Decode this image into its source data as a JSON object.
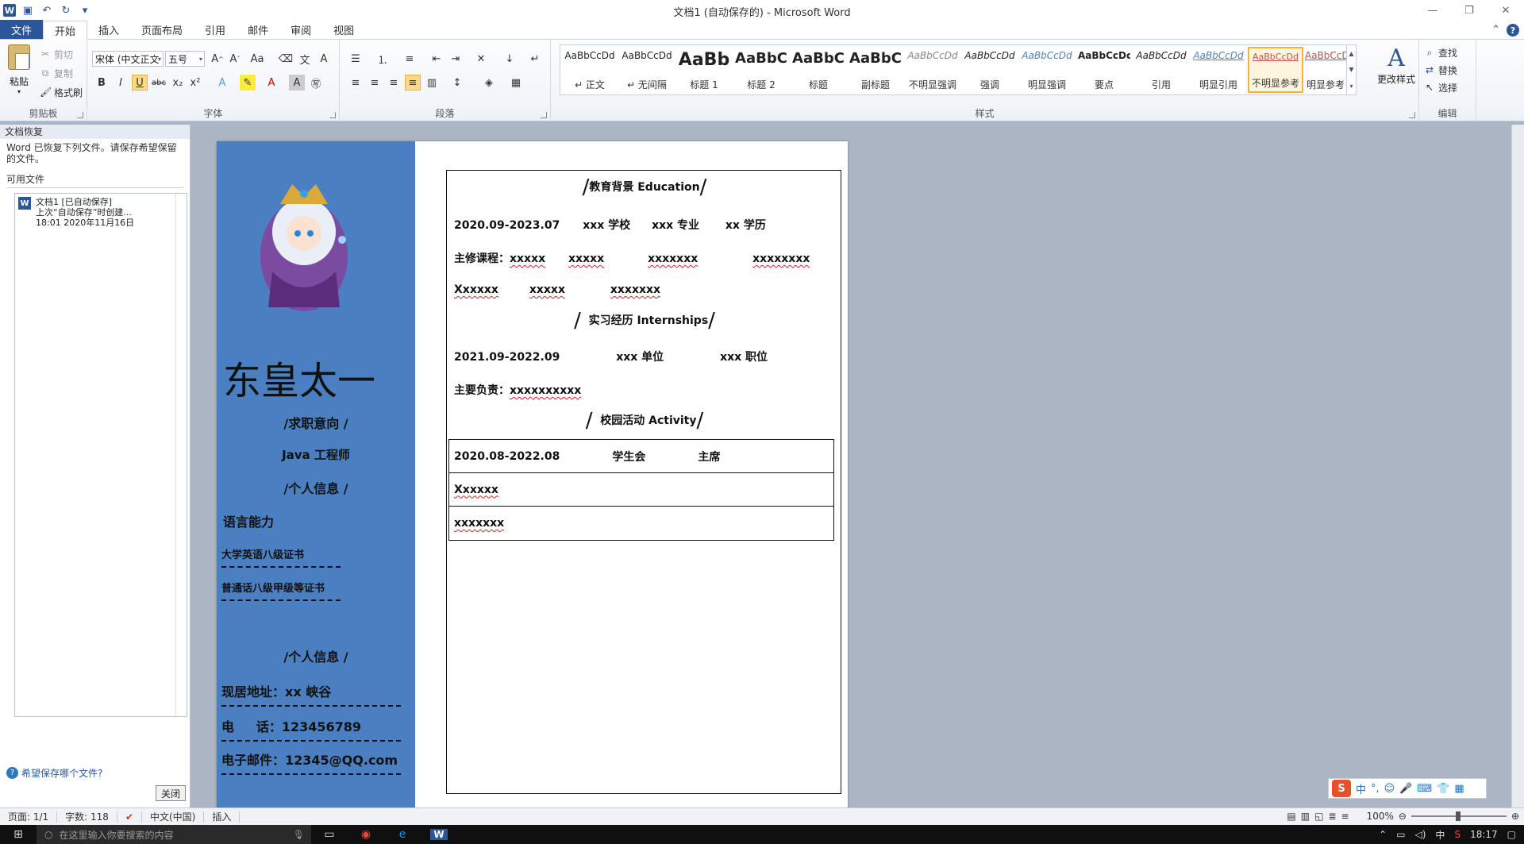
{
  "titlebar": {
    "title": "文档1 (自动保存的) - Microsoft Word",
    "logo": "W",
    "qat_icons": [
      "save-icon",
      "undo-icon",
      "redo-icon",
      "customize-icon"
    ]
  },
  "tabs": {
    "file": "文件",
    "items": [
      "开始",
      "插入",
      "页面布局",
      "引用",
      "邮件",
      "审阅",
      "视图"
    ]
  },
  "clipboard": {
    "paste": "粘贴",
    "cut": "剪切",
    "copy": "复制",
    "format_painter": "格式刷",
    "label": "剪贴板"
  },
  "font": {
    "name": "宋体 (中文正文",
    "size": "五号",
    "label": "字体"
  },
  "paragraph": {
    "label": "段落"
  },
  "styles": {
    "label": "样式",
    "items": [
      {
        "sample": "AaBbCcDd",
        "name": "↵ 正文"
      },
      {
        "sample": "AaBbCcDd",
        "name": "↵ 无间隔"
      },
      {
        "sample": "AaBb",
        "name": "标题 1"
      },
      {
        "sample": "AaBbC",
        "name": "标题 2"
      },
      {
        "sample": "AaBbC",
        "name": "标题"
      },
      {
        "sample": "AaBbC",
        "name": "副标题"
      },
      {
        "sample": "AaBbCcDd",
        "name": "不明显强调"
      },
      {
        "sample": "AaBbCcDd",
        "name": "强调"
      },
      {
        "sample": "AaBbCcDd",
        "name": "明显强调"
      },
      {
        "sample": "AaBbCcDd",
        "name": "要点"
      },
      {
        "sample": "AaBbCcDd",
        "name": "引用"
      },
      {
        "sample": "AaBbCcDd",
        "name": "明显引用"
      },
      {
        "sample": "AaBbCcDd",
        "name": "不明显参考"
      },
      {
        "sample": "AaBbCcDd",
        "name": "明显参考"
      }
    ],
    "change_styles": "更改样式"
  },
  "editing": {
    "label": "编辑",
    "find": "查找",
    "replace": "替换",
    "select": "选择"
  },
  "recovery": {
    "title": "文档恢复",
    "message": "Word 已恢复下列文件。请保存希望保留的文件。",
    "section": "可用文件",
    "file_name": "文档1 [已自动保存]",
    "file_desc": "上次“自动保存”时创建...",
    "file_time": "18:01 2020年11月16日",
    "help_link": "希望保存哪个文件?",
    "close": "关闭"
  },
  "resume": {
    "name": "东皇太一",
    "job_intent": "/求职意向 /",
    "job": "Java 工程师",
    "personal_info": "/个人信息 /",
    "language": "语言能力",
    "cert1": "大学英语八级证书",
    "cert2": "普通话八级甲级等证书",
    "personal_info2": "/个人信息 /",
    "address": "现居地址：xx 峡谷",
    "phone": "电     话：123456789",
    "email": "电子邮件：12345@QQ.com",
    "edu_head": "教育背景 Education",
    "edu_line": [
      "2020.09-2023.07",
      "xxx 学校",
      "xxx 专业",
      "xx 学历"
    ],
    "courses_label": "主修课程：",
    "courses1": [
      "xxxxx",
      "xxxxx",
      "xxxxxxx",
      "xxxxxxxx"
    ],
    "courses2": [
      "Xxxxxx",
      "xxxxx",
      "xxxxxxx"
    ],
    "intern_head": "实习经历 Internships",
    "intern_line": [
      "2021.09-2022.09",
      "xxx 单位",
      "xxx 职位"
    ],
    "duty_label": "主要负责：",
    "duty": "xxxxxxxxxx",
    "campus_head": "校园活动 Activity",
    "act_line": [
      "2020.08-2022.08",
      "学生会",
      "主席"
    ],
    "act_row2": "Xxxxxx",
    "act_row3": "xxxxxxx"
  },
  "statusbar": {
    "page": "页面: 1/1",
    "words": "字数: 118",
    "lang": "中文(中国)",
    "mode": "插入",
    "zoom": "100%"
  },
  "ime": {
    "logo": "S",
    "mode": "中"
  },
  "taskbar": {
    "search_placeholder": "在这里输入你要搜索的内容",
    "time": "18:17",
    "ime_indicator": "中"
  },
  "colors": {
    "word_blue": "#2b579a",
    "resume_blue": "#4a7fc1",
    "selected_style": "#f4b63a"
  }
}
